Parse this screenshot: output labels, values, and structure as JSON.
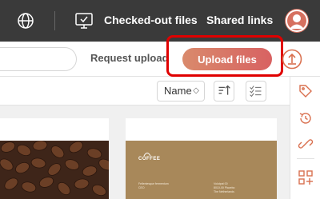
{
  "header": {
    "nav_checked_out": "Checked-out files",
    "nav_shared_links": "Shared links",
    "icons": [
      "globe-icon",
      "monitor-icon",
      "user-avatar-icon"
    ]
  },
  "toolbar": {
    "search_placeholder": "",
    "request_upload_label": "Request upload",
    "upload_files_label": "Upload files",
    "upload_icon": "upload-arrow-icon"
  },
  "viewbar": {
    "sort_value": "Name",
    "sort_chevron": "◇",
    "icons": [
      "sort-direction-icon",
      "select-all-icon"
    ]
  },
  "sidebar_right": {
    "icons": [
      "tag-icon",
      "history-icon",
      "link-icon",
      "add-widget-icon"
    ]
  },
  "content": {
    "card2_brand": "COFFEE",
    "card2_lines": [
      "Fellentesque fermentum",
      "CEO",
      "Volutpat 00",
      "8010-00 Placebo",
      "The Netherlands"
    ]
  },
  "colors": {
    "topbar": "#3a3a3a",
    "upload_button_start": "#d98a6c",
    "upload_button_end": "#d86262",
    "highlight": "#e00000",
    "accent": "#d9704f",
    "card_brown": "#a8885a"
  }
}
